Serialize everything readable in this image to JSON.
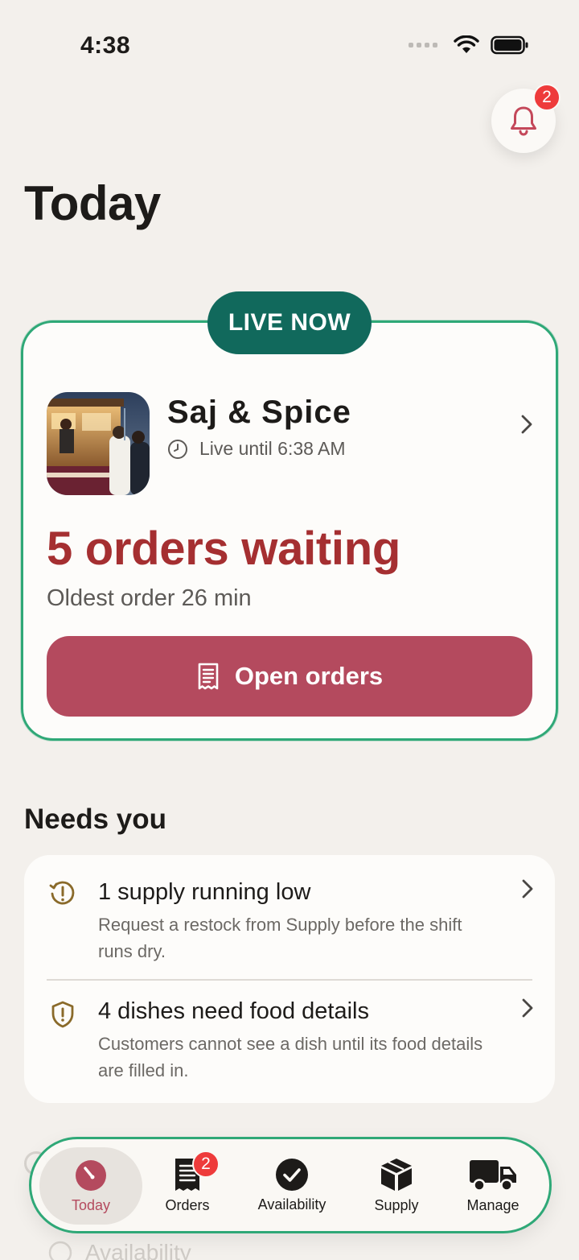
{
  "status_bar": {
    "time": "4:38"
  },
  "notifications": {
    "badge_count": "2"
  },
  "page_title": "Today",
  "live_card": {
    "status_label": "LIVE NOW",
    "venue_name": "Saj & Spice",
    "live_until": "Live until 6:38 AM",
    "orders_waiting": "5 orders waiting",
    "oldest_order": "Oldest order 26 min",
    "open_orders_label": "Open orders"
  },
  "needs_you": {
    "title": "Needs you",
    "items": [
      {
        "title": "1 supply running low",
        "description": "Request a restock from Supply before the shift runs dry."
      },
      {
        "title": "4 dishes need food details",
        "description": "Customers cannot see a dish until its food details are filled in."
      }
    ]
  },
  "ghost_text": "Availability",
  "tab_bar": {
    "tabs": [
      {
        "label": "Today"
      },
      {
        "label": "Orders",
        "badge": "2"
      },
      {
        "label": "Availability"
      },
      {
        "label": "Supply"
      },
      {
        "label": "Manage"
      }
    ]
  },
  "colors": {
    "background": "#f3f0ec",
    "live_pill": "#11695c",
    "orders_waiting_text": "#a52f31",
    "primary_button": "#b44a5e",
    "highlight_border": "#2fa877",
    "badge": "#ee3b3b"
  }
}
